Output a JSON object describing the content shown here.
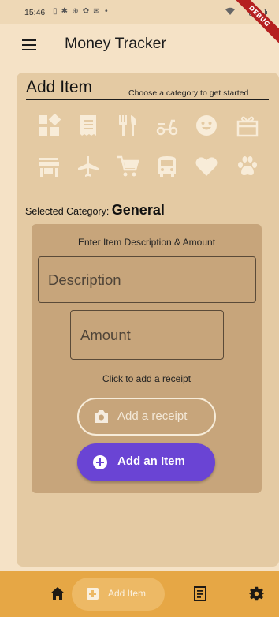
{
  "status_bar": {
    "time": "15:46",
    "icons": "▯ ✱ ⊕ ✿ ✉ •",
    "wifi_icon": "wifi-icon",
    "battery_icon": "battery-icon"
  },
  "app_bar": {
    "title": "Money Tracker",
    "menu_icon": "menu-icon",
    "debug_banner": "DEBUG"
  },
  "add_item": {
    "title": "Add Item",
    "subtitle": "Choose a category to get started",
    "categories": [
      {
        "id": "general",
        "icon": "widgets-icon"
      },
      {
        "id": "bills",
        "icon": "receipt-long-icon"
      },
      {
        "id": "food",
        "icon": "restaurant-icon"
      },
      {
        "id": "transport-scooter",
        "icon": "scooter-icon"
      },
      {
        "id": "entertainment",
        "icon": "smiley-icon"
      },
      {
        "id": "gifts",
        "icon": "gift-box-icon"
      },
      {
        "id": "store",
        "icon": "storefront-icon"
      },
      {
        "id": "travel",
        "icon": "airplane-icon"
      },
      {
        "id": "shopping",
        "icon": "shopping-cart-icon"
      },
      {
        "id": "bus",
        "icon": "bus-icon"
      },
      {
        "id": "health",
        "icon": "heart-icon"
      },
      {
        "id": "pets",
        "icon": "paw-icon"
      }
    ],
    "selected_label": "Selected Category: ",
    "selected_value": "General",
    "form": {
      "heading": "Enter Item Description & Amount",
      "description_placeholder": "Description",
      "description_value": "",
      "amount_placeholder": "Amount",
      "amount_value": "",
      "receipt_hint": "Click to add a receipt",
      "receipt_button": "Add a receipt",
      "add_button": "Add an Item"
    }
  },
  "bottom_nav": {
    "items": [
      {
        "id": "home",
        "icon": "home-icon",
        "label": ""
      },
      {
        "id": "add-item",
        "icon": "add-box-icon",
        "label": "Add Item",
        "active": true
      },
      {
        "id": "receipts",
        "icon": "receipt-icon",
        "label": ""
      },
      {
        "id": "settings",
        "icon": "gear-icon",
        "label": ""
      }
    ]
  },
  "colors": {
    "background": "#f5e2c6",
    "card": "#e4caa3",
    "inner_card": "#c7a57b",
    "icon_fill": "#f8ecd8",
    "primary_button": "#6a44d4",
    "bottom_nav": "#e6a745",
    "bottom_nav_active": "#edb965"
  }
}
